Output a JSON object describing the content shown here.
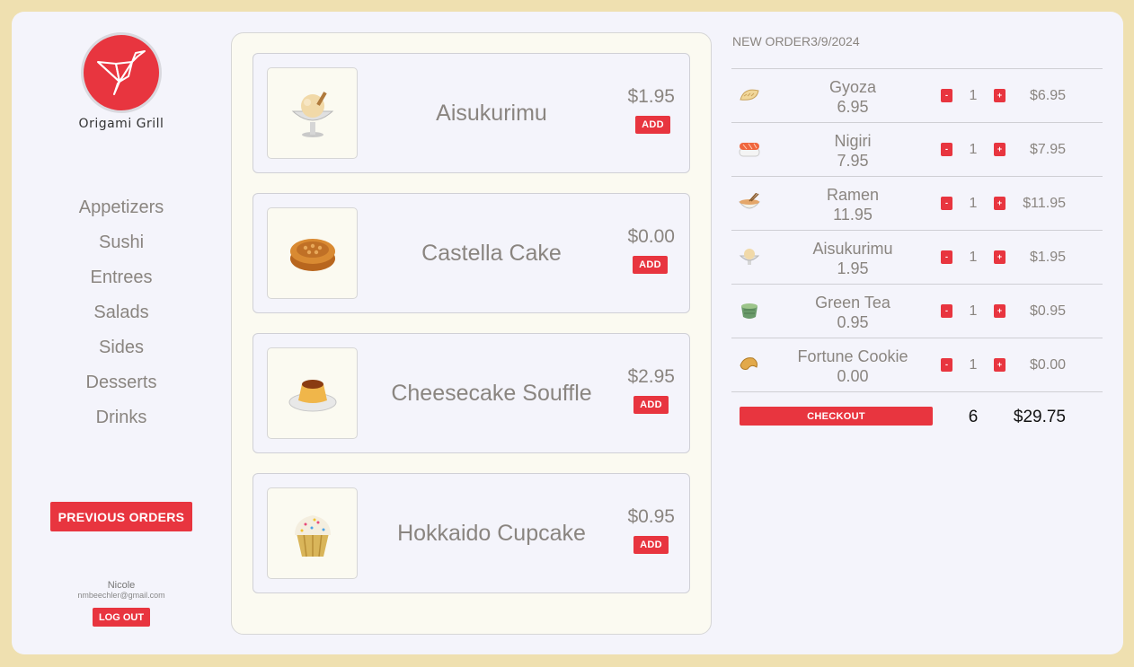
{
  "brand": {
    "name": "Origami Grill"
  },
  "categories": [
    "Appetizers",
    "Sushi",
    "Entrees",
    "Salads",
    "Sides",
    "Desserts",
    "Drinks"
  ],
  "buttons": {
    "previous_orders": "PREVIOUS ORDERS",
    "logout": "LOG OUT",
    "add": "ADD",
    "checkout": "CHECKOUT",
    "minus": "-",
    "plus": "+"
  },
  "user": {
    "name": "Nicole",
    "email": "nmbeechler@gmail.com"
  },
  "menu_items": [
    {
      "name": "Aisukurimu",
      "price": "$1.95",
      "icon": "ice-cream-icon"
    },
    {
      "name": "Castella Cake",
      "price": "$0.00",
      "icon": "mooncake-icon"
    },
    {
      "name": "Cheesecake Souffle",
      "price": "$2.95",
      "icon": "custard-icon"
    },
    {
      "name": "Hokkaido Cupcake",
      "price": "$0.95",
      "icon": "cupcake-icon"
    }
  ],
  "order": {
    "title": "NEW ORDER3/9/2024",
    "items": [
      {
        "name": "Gyoza",
        "unit_price": "6.95",
        "qty": "1",
        "total": "$6.95",
        "icon": "dumpling-icon"
      },
      {
        "name": "Nigiri",
        "unit_price": "7.95",
        "qty": "1",
        "total": "$7.95",
        "icon": "sushi-icon"
      },
      {
        "name": "Ramen",
        "unit_price": "11.95",
        "qty": "1",
        "total": "$11.95",
        "icon": "noodle-bowl-icon"
      },
      {
        "name": "Aisukurimu",
        "unit_price": "1.95",
        "qty": "1",
        "total": "$1.95",
        "icon": "ice-cream-icon"
      },
      {
        "name": "Green Tea",
        "unit_price": "0.95",
        "qty": "1",
        "total": "$0.95",
        "icon": "tea-icon"
      },
      {
        "name": "Fortune Cookie",
        "unit_price": "0.00",
        "qty": "1",
        "total": "$0.00",
        "icon": "fortune-cookie-icon"
      }
    ],
    "count": "6",
    "total": "$29.75"
  },
  "colors": {
    "accent": "#e8353f",
    "background": "#efe0b0",
    "panel": "#f4f4fb",
    "menu_panel": "#fbfaf1",
    "muted_text": "#8a8580"
  }
}
